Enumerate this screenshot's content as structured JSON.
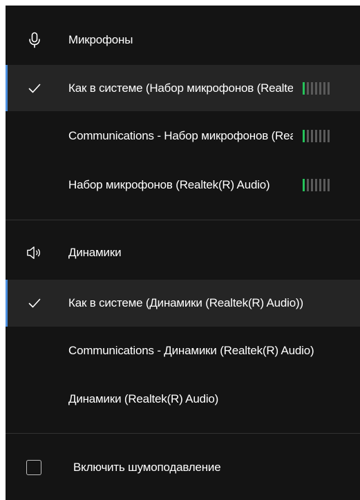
{
  "microphones": {
    "header": "Микрофоны",
    "header_icon": "microphone-icon",
    "items": [
      {
        "label": "Как в системе (Набор микрофонов (Realtek(R) Audio))",
        "selected": true,
        "level_bars_on": 1,
        "level_bars_total": 7
      },
      {
        "label": "Communications - Набор микрофонов (Realtek(R) Audio)",
        "selected": false,
        "level_bars_on": 1,
        "level_bars_total": 7
      },
      {
        "label": "Набор микрофонов (Realtek(R) Audio)",
        "selected": false,
        "level_bars_on": 1,
        "level_bars_total": 7
      }
    ]
  },
  "speakers": {
    "header": "Динамики",
    "header_icon": "speaker-icon",
    "items": [
      {
        "label": "Как в системе (Динамики (Realtek(R) Audio))",
        "selected": true
      },
      {
        "label": "Communications - Динамики (Realtek(R) Audio)",
        "selected": false
      },
      {
        "label": "Динамики (Realtek(R) Audio)",
        "selected": false
      }
    ]
  },
  "noise_suppression": {
    "label": "Включить шумоподавление",
    "checked": false
  },
  "colors": {
    "background": "#141414",
    "selected_row": "#252525",
    "accent": "#4a8fe0",
    "meter_on": "#25c25a",
    "meter_off": "#5a5a5a"
  }
}
